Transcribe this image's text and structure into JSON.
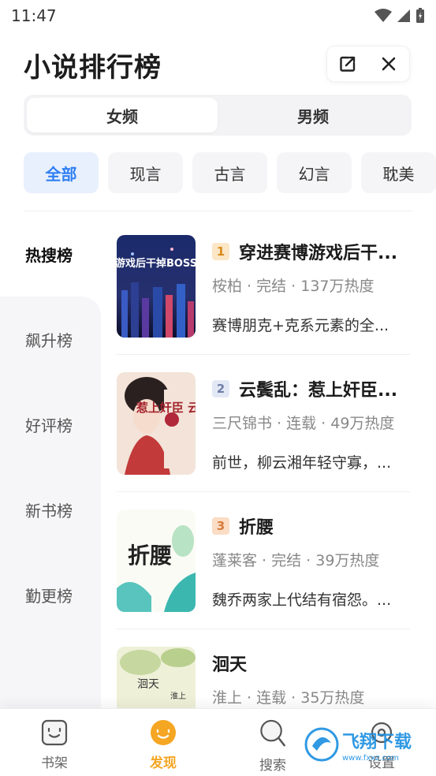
{
  "status_bar": {
    "time": "11:47"
  },
  "header": {
    "title": "小说排行榜"
  },
  "gender_tabs": [
    {
      "label": "女频",
      "active": true
    },
    {
      "label": "男频",
      "active": false
    }
  ],
  "categories": [
    {
      "label": "全部",
      "active": true
    },
    {
      "label": "现言",
      "active": false
    },
    {
      "label": "古言",
      "active": false
    },
    {
      "label": "幻言",
      "active": false
    },
    {
      "label": "耽美",
      "active": false
    }
  ],
  "rank_nav": [
    {
      "label": "热搜榜",
      "active": true
    },
    {
      "label": "飙升榜",
      "active": false
    },
    {
      "label": "好评榜",
      "active": false
    },
    {
      "label": "新书榜",
      "active": false
    },
    {
      "label": "勤更榜",
      "active": false
    }
  ],
  "books": [
    {
      "rank": "1",
      "title": "穿进赛博游戏后干...",
      "meta": "桉柏 · 完结 · 137万热度",
      "desc": "赛博朋克+克系元素的全..."
    },
    {
      "rank": "2",
      "title": "云鬓乱：惹上奸臣...",
      "meta": "三尺锦书 · 连载 · 49万热度",
      "desc": "前世，柳云湘年轻守寡，..."
    },
    {
      "rank": "3",
      "title": "折腰",
      "meta": "蓬莱客 · 完结 · 39万热度",
      "desc": "魏乔两家上代结有宿怨。..."
    },
    {
      "rank": "",
      "title": "洄天",
      "meta": "淮上 · 连载 · 35万热度",
      "desc": ""
    }
  ],
  "covers": {
    "c1_text": "穿进赛博游戏后干掉BOSS成功上位",
    "c2_text": "惹上奸臣 云鬓乱",
    "c3_text": "折腰",
    "c4_title": "洄天",
    "c4_author": "淮上"
  },
  "bottom_nav": [
    {
      "label": "书架",
      "active": false
    },
    {
      "label": "发现",
      "active": true
    },
    {
      "label": "搜索",
      "active": false
    },
    {
      "label": "设置",
      "active": false
    }
  ],
  "watermark": {
    "text": "飞翔下载",
    "url_text": "www.fxxz.com"
  },
  "colors": {
    "accent_blue": "#2f7ff3",
    "accent_orange": "#f5a623",
    "rank1_bg": "#fbe6c6",
    "rank1_fg": "#d98b1e",
    "rank2_bg": "#e3e8f5",
    "rank2_fg": "#6f7fa8",
    "rank3_bg": "#fbdcc4",
    "rank3_fg": "#d77a3a"
  }
}
